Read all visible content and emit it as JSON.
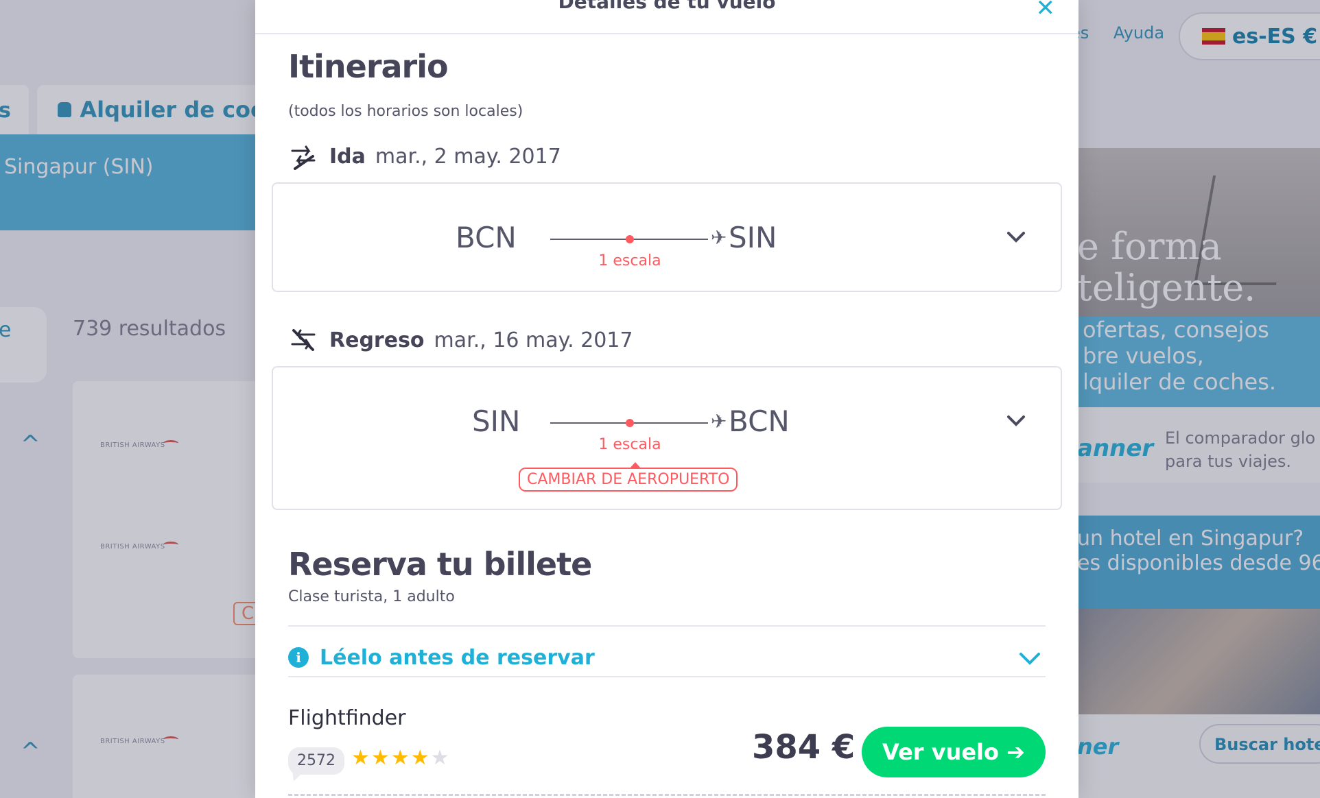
{
  "background": {
    "top_links": [
      "es",
      "Ayuda"
    ],
    "language": "es-ES €",
    "tab_left_label": "s",
    "tab_car_label": "Alquiler de coc",
    "search_destination": "Singapur (SIN)",
    "filter_pill_label": "e",
    "results_count": "739 resultados",
    "airline_logo": "BRITISH AIRWAYS",
    "card_badge": "C",
    "ad": {
      "line1": "e forma",
      "line2": "teligente.",
      "blue_text": [
        "ofertas, consejos",
        "bre vuelos,",
        "lquiler de coches."
      ],
      "brand_logo": "anner",
      "brand_desc": [
        "El comparador glo",
        "para tus viajes."
      ],
      "hotel_line1": "un hotel en Singapur?",
      "hotel_line2": "es disponibles desde 96",
      "footer_logo": "ner",
      "footer_button": "Buscar hotel"
    }
  },
  "modal": {
    "title": "Detalles de tu vuelo",
    "itinerary": {
      "title": "Itinerario",
      "subtitle": "(todos los horarios son locales)"
    },
    "outbound": {
      "label": "Ida",
      "date": "mar., 2 may. 2017",
      "from": "BCN",
      "to": "SIN",
      "stops": "1 escala"
    },
    "return": {
      "label": "Regreso",
      "date": "mar., 16 may. 2017",
      "from": "SIN",
      "to": "BCN",
      "stops": "1 escala",
      "airport_change": "CAMBIAR DE AEROPUERTO"
    },
    "booking": {
      "title": "Reserva tu billete",
      "subtitle": "Clase turista, 1 adulto",
      "info_toggle": "Léelo antes de reservar",
      "agent": "Flightfinder",
      "review_count": "2572",
      "rating": 4,
      "rating_max": 5,
      "price": "384 €",
      "cta": "Ver vuelo ➔"
    }
  },
  "colors": {
    "accent": "#1fb0d8",
    "stop_red": "#ff5a5f",
    "cta_green": "#00d775",
    "star_yellow": "#ffbb00"
  },
  "icons": [
    "close-icon",
    "takeoff-icon",
    "landing-icon",
    "chevron-down-icon",
    "info-icon",
    "star-icon",
    "plane-arrow-icon",
    "car-icon",
    "flag-spain-icon"
  ]
}
